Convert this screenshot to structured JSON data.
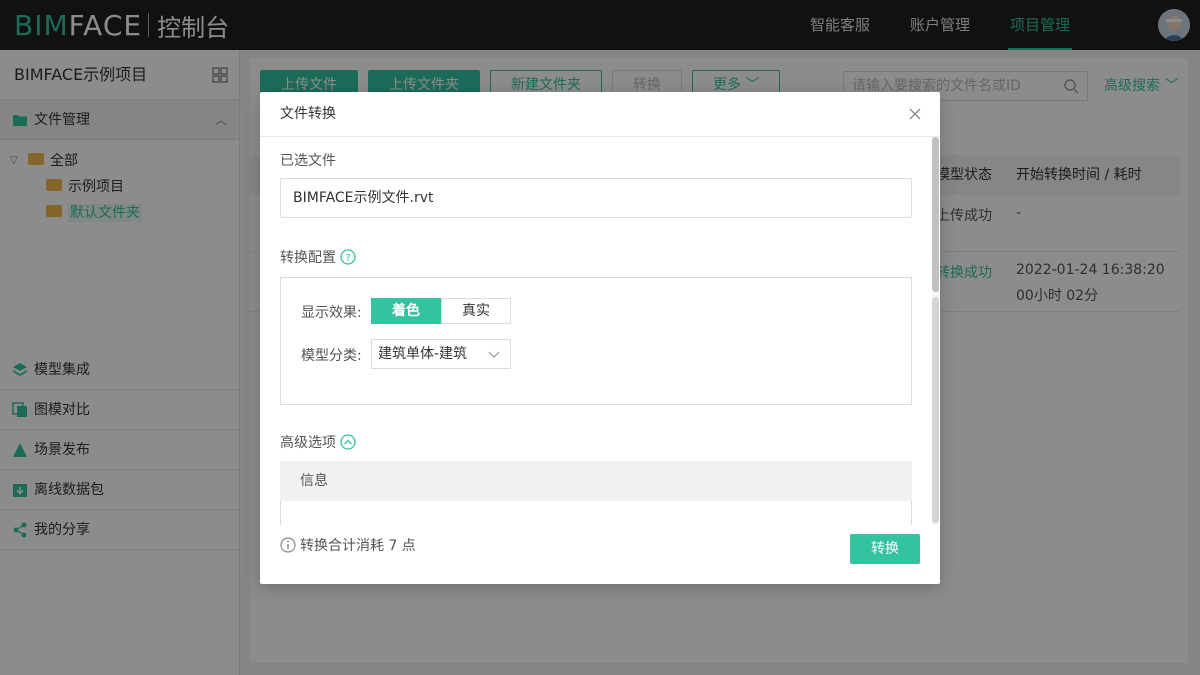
{
  "header": {
    "logo_bim": "BIM",
    "logo_face": "FACE",
    "logo_sub": "控制台",
    "nav": [
      {
        "label": "智能客服"
      },
      {
        "label": "账户管理"
      },
      {
        "label": "项目管理",
        "active": true
      }
    ]
  },
  "sidebar": {
    "project_name": "BIMFACE示例项目",
    "file_section": "文件管理",
    "tree": {
      "root": "全部",
      "children": [
        "示例项目",
        "默认文件夹"
      ]
    },
    "menu": [
      "模型集成",
      "图模对比",
      "场景发布",
      "离线数据包",
      "我的分享"
    ]
  },
  "main": {
    "toolbar": [
      "上传文件",
      "上传文件夹",
      "新建文件夹",
      "转换",
      "更多"
    ],
    "search_placeholder": "请输入要搜索的文件名或ID",
    "advanced_search": "高级搜索",
    "columns": {
      "status": "模型状态",
      "time": "开始转换时间 / 耗时"
    },
    "rows": [
      {
        "status": "上传成功",
        "time": "-",
        "duration": ""
      },
      {
        "status": "转换成功",
        "time": "2022-01-24 16:38:20",
        "duration": "00小时 02分"
      }
    ]
  },
  "modal": {
    "title": "文件转换",
    "selected_label": "已选文件",
    "selected_file": "BIMFACE示例文件.rvt",
    "config_label": "转换配置",
    "display_label": "显示效果:",
    "display_options": [
      "着色",
      "真实"
    ],
    "category_label": "模型分类:",
    "category_value": "建筑单体-建筑",
    "advanced_label": "高级选项",
    "info_label": "信息",
    "cost_text": "转换合计消耗 7 点",
    "convert_button": "转换"
  },
  "colors": {
    "accent": "#34c3a0",
    "header_bg": "#1f1f1f"
  }
}
